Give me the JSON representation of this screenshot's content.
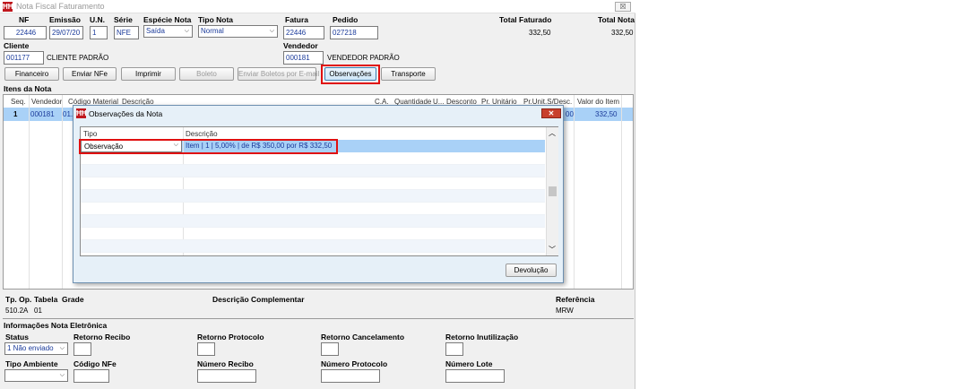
{
  "window": {
    "title": "Nota Fiscal Faturamento",
    "close_glyph": "☒",
    "app_icon_glyph": "ĦĦ"
  },
  "header": {
    "nf": {
      "label": "NF",
      "value": "22446"
    },
    "emissao": {
      "label": "Emissão",
      "value": "29/07/20"
    },
    "un": {
      "label": "U.N.",
      "value": "1"
    },
    "serie": {
      "label": "Série",
      "value": "NFE"
    },
    "especie": {
      "label": "Espécie Nota",
      "value": "Saída"
    },
    "tipo_nota": {
      "label": "Tipo Nota",
      "value": "Normal"
    },
    "fatura": {
      "label": "Fatura",
      "value": "22446"
    },
    "pedido": {
      "label": "Pedido",
      "value": "027218"
    },
    "total_faturado": {
      "label": "Total Faturado",
      "value": "332,50"
    },
    "total_nota": {
      "label": "Total Nota",
      "value": "332,50"
    },
    "cliente": {
      "label": "Cliente",
      "code": "001177",
      "name": "CLIENTE PADRÃO"
    },
    "vendedor": {
      "label": "Vendedor",
      "code": "000181",
      "name": "VENDEDOR PADRÃO"
    }
  },
  "toolbar": {
    "financeiro": "Financeiro",
    "enviar_nfe": "Enviar NFe",
    "imprimir": "Imprimir",
    "boleto": "Boleto",
    "enviar_boletos": "Enviar Boletos por E-mail",
    "observacoes": "Observações",
    "transporte": "Transporte"
  },
  "items": {
    "section_title": "Itens da Nota",
    "columns": [
      "Seq.",
      "Vendedor",
      "Código Material",
      "Descrição",
      "C.A.",
      "Quantidade",
      "U...",
      "Desconto",
      "Pr. Unitário",
      "Pr.Unit.S/Desc.",
      "Valor do Item"
    ],
    "row": {
      "seq": "1",
      "vendedor": "000181",
      "codigo": "01.",
      "pr_unit_sdesc": "00",
      "valor": "332,50"
    }
  },
  "dialog": {
    "title": "Observações da Nota",
    "close_glyph": "✕",
    "columns": [
      "Tipo",
      "Descrição"
    ],
    "rows": [
      {
        "tipo": "Observação",
        "descricao": "Item  | 1 | 5,00% | de R$ 350,00 por R$ 332,50"
      }
    ],
    "button": "Devolução",
    "scroll_up": "︿",
    "scroll_down": "﹀"
  },
  "bottom": {
    "tp_op": {
      "label": "Tp. Op.",
      "value": "510.2A"
    },
    "tabela": {
      "label": "Tabela",
      "value": "01"
    },
    "grade": {
      "label": "Grade"
    },
    "descricao_complementar": {
      "label": "Descrição Complementar"
    },
    "referencia": {
      "label": "Referência",
      "value": "MRW"
    }
  },
  "nfe": {
    "section_title": "Informações Nota Eletrônica",
    "status": {
      "label": "Status",
      "value": "1 Não enviado"
    },
    "retorno_recibo": {
      "label": "Retorno Recibo"
    },
    "retorno_protocolo": {
      "label": "Retorno Protocolo"
    },
    "retorno_cancelamento": {
      "label": "Retorno Cancelamento"
    },
    "retorno_inutilizacao": {
      "label": "Retorno Inutilização"
    },
    "tipo_ambiente": {
      "label": "Tipo Ambiente",
      "value": ""
    },
    "codigo_nfe": {
      "label": "Código NFe"
    },
    "numero_recibo": {
      "label": "Número Recibo"
    },
    "numero_protocolo": {
      "label": "Número Protocolo"
    },
    "numero_lote": {
      "label": "Número Lote"
    }
  },
  "colors": {
    "accent_red": "#e01010",
    "selection": "#a9d1f7",
    "dialog_bg": "#e6f0f8"
  }
}
